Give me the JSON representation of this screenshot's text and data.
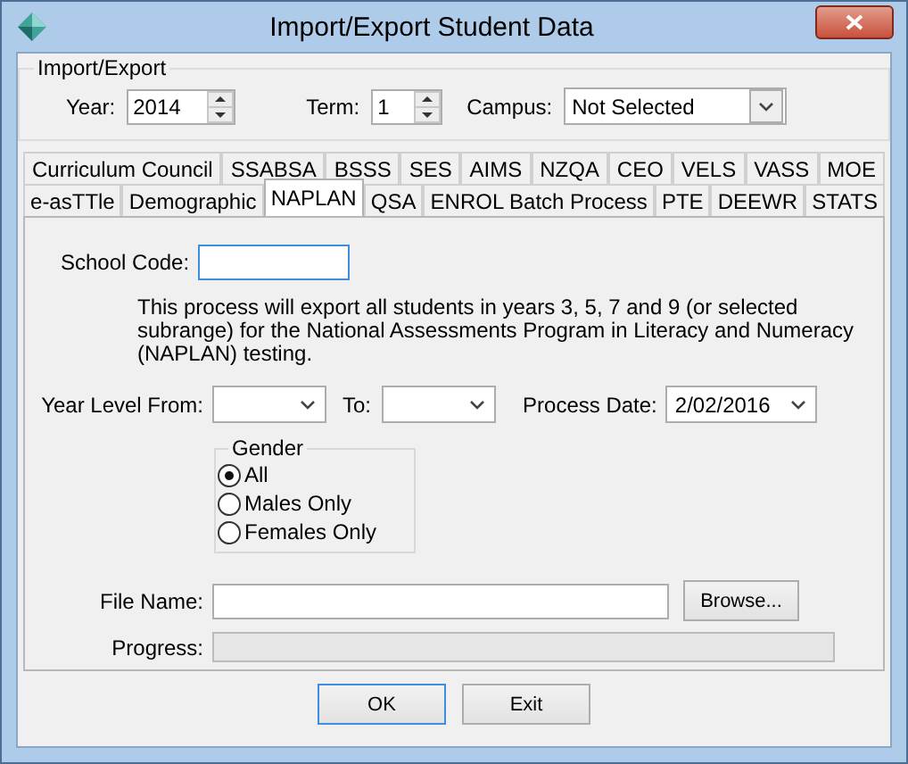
{
  "window": {
    "title": "Import/Export Student Data"
  },
  "import_export": {
    "title": "Import/Export",
    "year": {
      "label": "Year:",
      "value": "2014"
    },
    "term": {
      "label": "Term:",
      "value": "1"
    },
    "campus": {
      "label": "Campus:",
      "value": "Not Selected"
    }
  },
  "tab_rows": [
    [
      {
        "label": "Curriculum Council",
        "selected": false
      },
      {
        "label": "SSABSA",
        "selected": false
      },
      {
        "label": "BSSS",
        "selected": false
      },
      {
        "label": "SES",
        "selected": false
      },
      {
        "label": "AIMS",
        "selected": false
      },
      {
        "label": "NZQA",
        "selected": false
      },
      {
        "label": "CEO",
        "selected": false
      },
      {
        "label": "VELS",
        "selected": false
      },
      {
        "label": "VASS",
        "selected": false
      },
      {
        "label": "MOE",
        "selected": false
      }
    ],
    [
      {
        "label": "e-asTTle",
        "selected": false
      },
      {
        "label": "Demographic",
        "selected": false
      },
      {
        "label": "NAPLAN",
        "selected": true
      },
      {
        "label": "QSA",
        "selected": false
      },
      {
        "label": "ENROL Batch Process",
        "selected": false
      },
      {
        "label": "PTE",
        "selected": false
      },
      {
        "label": "DEEWR",
        "selected": false
      },
      {
        "label": "STATS",
        "selected": false
      }
    ]
  ],
  "naplan": {
    "school_code": {
      "label": "School Code:",
      "focused": true
    },
    "description": "This process will export all students in years 3, 5, 7 and 9 (or selected subrange) for the National Assessments Program in Literacy and Numeracy (NAPLAN) testing.",
    "year_level_from": {
      "label": "Year Level From:"
    },
    "to": {
      "label": "To:"
    },
    "process_date": {
      "label": "Process Date:",
      "value": "2/02/2016"
    },
    "gender": {
      "title": "Gender",
      "options": [
        {
          "label": "All",
          "selected": true
        },
        {
          "label": "Males Only",
          "selected": false
        },
        {
          "label": "Females Only",
          "selected": false
        }
      ]
    },
    "file_name": {
      "label": "File Name:"
    },
    "browse_button": "Browse...",
    "progress": {
      "label": "Progress:",
      "level": 0
    }
  },
  "buttons": [
    {
      "label": "OK",
      "default": true
    },
    {
      "label": "Exit",
      "default": false
    }
  ]
}
